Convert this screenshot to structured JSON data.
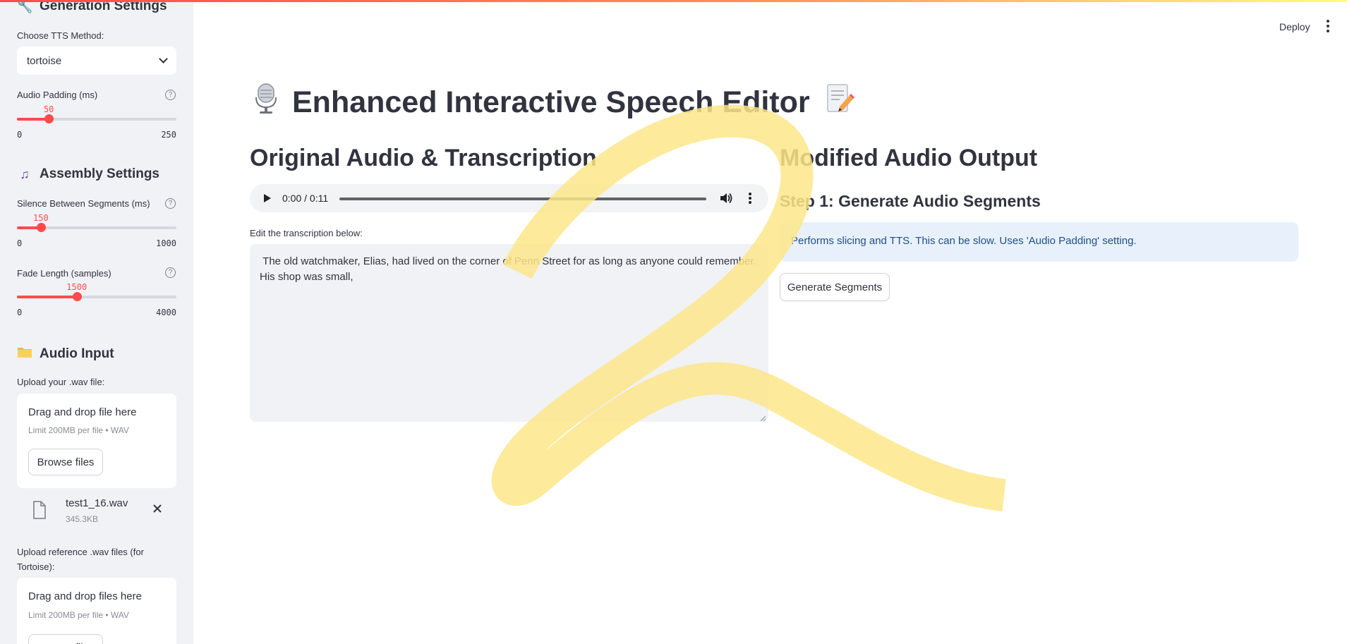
{
  "sidebar": {
    "generation": {
      "title": "Generation Settings",
      "icon": "wrench-icon"
    },
    "tts_method": {
      "label": "Choose TTS Method:",
      "value": "tortoise"
    },
    "audio_padding": {
      "label": "Audio Padding (ms)",
      "value": "50",
      "min": "0",
      "max": "250",
      "fraction": 0.2
    },
    "assembly": {
      "title": "Assembly Settings",
      "icon": "music-notes-icon"
    },
    "silence": {
      "label": "Silence Between Segments (ms)",
      "value": "150",
      "min": "0",
      "max": "1000",
      "fraction": 0.15
    },
    "fade": {
      "label": "Fade Length (samples)",
      "value": "1500",
      "min": "0",
      "max": "4000",
      "fraction": 0.375
    },
    "audio_input": {
      "title": "Audio Input",
      "icon": "folder-icon"
    },
    "upload_wav": {
      "label": "Upload your .wav file:",
      "drop_title": "Drag and drop file here",
      "drop_limit": "Limit 200MB per file • WAV",
      "browse": "Browse files"
    },
    "uploaded_file": {
      "name": "test1_16.wav",
      "size": "345.3KB"
    },
    "upload_ref": {
      "label": "Upload reference .wav files (for Tortoise):",
      "drop_title": "Drag and drop files here",
      "drop_limit": "Limit 200MB per file • WAV",
      "browse": "Browse files"
    }
  },
  "header": {
    "deploy": "Deploy"
  },
  "main": {
    "title": "Enhanced Interactive Speech Editor",
    "left": {
      "heading": "Original Audio & Transcription",
      "audio_time": "0:00 / 0:11",
      "textarea_label": "Edit the transcription below:",
      "transcription": " The old watchmaker, Elias, had lived on the corner of Penn Street for as long as anyone could remember. His shop was small,"
    },
    "right": {
      "heading": "Modified Audio Output",
      "step1": "Step 1: Generate Audio Segments",
      "info": "Performs slicing and TTS. This can be slow. Uses 'Audio Padding' setting.",
      "generate_button": "Generate Segments"
    }
  },
  "colors": {
    "accent": "#ff4b4b",
    "sidebar_bg": "#f0f2f6",
    "info_bg": "#e8f1fb",
    "info_text": "#1b4f8a",
    "annotation": "#fde68a"
  }
}
